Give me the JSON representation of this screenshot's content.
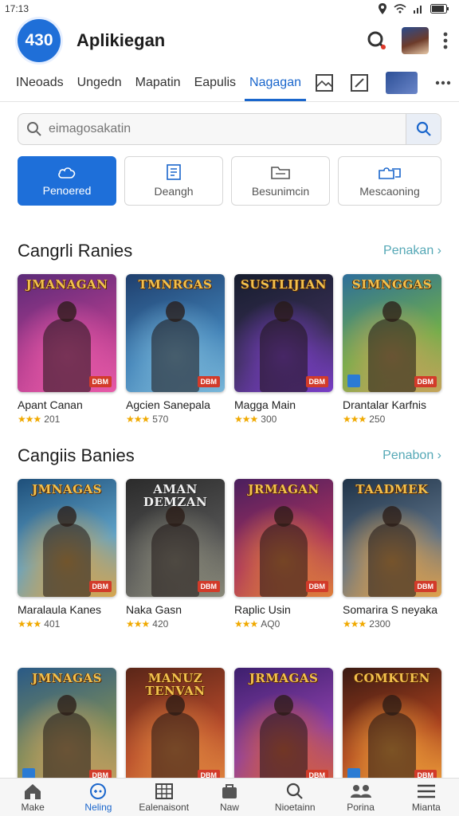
{
  "status": {
    "time": "17:13"
  },
  "app": {
    "logo_text": "430",
    "title": "Aplikiegan"
  },
  "tabs": [
    {
      "label": "INeoads"
    },
    {
      "label": "Ungedn"
    },
    {
      "label": "Mapatin"
    },
    {
      "label": "Eapulis"
    },
    {
      "label": "Nagagan"
    }
  ],
  "search": {
    "placeholder": "eimagosakatin"
  },
  "filters": [
    {
      "label": "Penoered",
      "icon": "cloud-icon"
    },
    {
      "label": "Deangh",
      "icon": "document-icon"
    },
    {
      "label": "Besunimcin",
      "icon": "folder-icon"
    },
    {
      "label": "Mescaoning",
      "icon": "puzzle-icon"
    }
  ],
  "sections": [
    {
      "title": "Cangrli Ranies",
      "more": "Penakan",
      "games": [
        {
          "name": "Apant Canan",
          "rating": "201",
          "cover_title": "JMANAGAN",
          "badge": "DBM",
          "colors": [
            "#5b2a78",
            "#b23d8e",
            "#e85aa8"
          ]
        },
        {
          "name": "Agcien Sanepala",
          "rating": "570",
          "cover_title": "TMNRGAS",
          "badge": "DBM",
          "colors": [
            "#1f3f6d",
            "#3f7fb5",
            "#79b7d9"
          ]
        },
        {
          "name": "Magga Main",
          "rating": "300",
          "cover_title": "SUSTLIJIAN",
          "badge": "DBM",
          "colors": [
            "#161d2e",
            "#3a2f55",
            "#7a3ec9"
          ]
        },
        {
          "name": "Drantalar Karfnis",
          "rating": "250",
          "cover_title": "SIMNGGAS",
          "badge": "DBM",
          "colors": [
            "#2d6e9a",
            "#6fae4a",
            "#c6a35a"
          ]
        }
      ]
    },
    {
      "title": "Cangiis Banies",
      "more": "Penabon",
      "games": [
        {
          "name": "Maralaula Kanes",
          "rating": "401",
          "cover_title": "JMNAGAS",
          "badge": "DBM",
          "colors": [
            "#1e4f7a",
            "#5fa3c9",
            "#d9a54b"
          ]
        },
        {
          "name": "Naka Gasn",
          "rating": "420",
          "cover_title": "AMAN DEMZAN",
          "badge": "DBM",
          "colors": [
            "#2b2b2b",
            "#545454",
            "#8a8a7a"
          ]
        },
        {
          "name": "Raplic Usin",
          "rating": "AQ0",
          "cover_title": "JRMAGAN",
          "badge": "DBM",
          "colors": [
            "#4a1f5e",
            "#a8315f",
            "#e0803a"
          ]
        },
        {
          "name": "Somarira S neyaka",
          "rating": "2300",
          "cover_title": "TAADMEK",
          "badge": "DBM",
          "colors": [
            "#1f3348",
            "#5d7288",
            "#e3a24a"
          ]
        }
      ]
    },
    {
      "title": "",
      "more": "",
      "games": [
        {
          "name": "",
          "rating": "",
          "cover_title": "JMNAGAS",
          "badge": "DBM",
          "colors": [
            "#2a5a86",
            "#7a8a5a",
            "#c8a060"
          ]
        },
        {
          "name": "",
          "rating": "",
          "cover_title": "MANUZ TENVAN",
          "badge": "DBM",
          "colors": [
            "#5a2618",
            "#b3482a",
            "#e2883f"
          ]
        },
        {
          "name": "",
          "rating": "",
          "cover_title": "JRMAGAS",
          "badge": "DBM",
          "colors": [
            "#3d1f6e",
            "#8a3fa8",
            "#d9603a"
          ]
        },
        {
          "name": "",
          "rating": "",
          "cover_title": "COMKUEN",
          "badge": "DBM",
          "colors": [
            "#3a1a12",
            "#a8401e",
            "#f0a03a"
          ]
        }
      ]
    }
  ],
  "bottom_nav": [
    {
      "label": "Make",
      "icon": "home-icon"
    },
    {
      "label": "Neling",
      "icon": "gamepad-icon"
    },
    {
      "label": "Ealenaisont",
      "icon": "grid-icon"
    },
    {
      "label": "Naw",
      "icon": "bag-icon"
    },
    {
      "label": "Nioetainn",
      "icon": "search-icon"
    },
    {
      "label": "Porina",
      "icon": "users-icon"
    },
    {
      "label": "Mianta",
      "icon": "menu-icon"
    }
  ]
}
